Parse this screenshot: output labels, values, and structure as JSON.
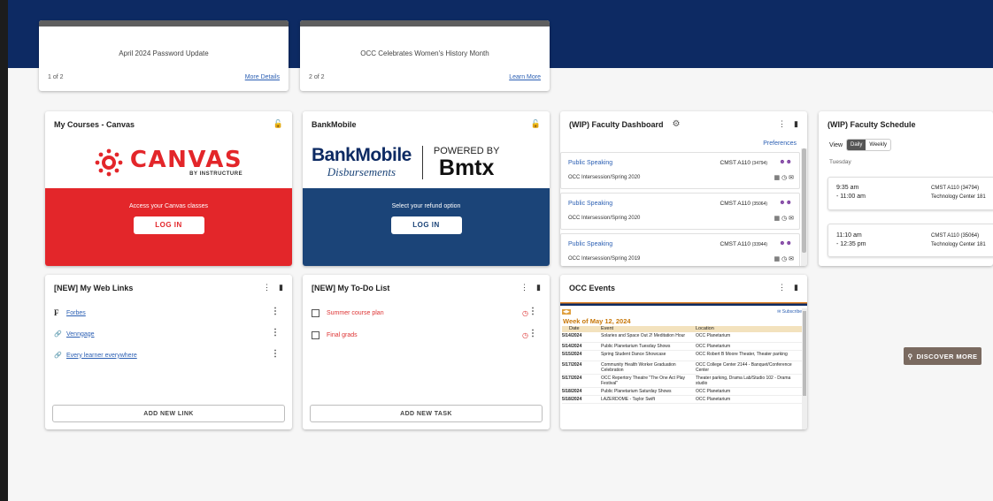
{
  "announcements": [
    {
      "title": "April 2024 Password Update",
      "counter": "1 of 2",
      "link": "More Details"
    },
    {
      "title": "OCC Celebrates Women's History Month",
      "counter": "2 of 2",
      "link": "Learn More"
    }
  ],
  "canvas": {
    "title": "My Courses - Canvas",
    "logo_text": "CANVAS",
    "logo_sub": "BY INSTRUCTURE",
    "message": "Access your Canvas classes",
    "button": "LOG IN"
  },
  "bankmobile": {
    "title": "BankMobile",
    "logo_main": "BankMobile",
    "logo_sub": "Disbursements",
    "powered": "POWERED BY",
    "bmtx": "Bmtx",
    "message": "Select your refund option",
    "button": "LOG IN"
  },
  "dashboard": {
    "title": "(WIP) Faculty Dashboard",
    "preferences": "Preferences",
    "courses": [
      {
        "name": "Public Speaking",
        "code": "CMST A110",
        "id": "(34794)",
        "term": "OCC Intersession/Spring 2020"
      },
      {
        "name": "Public Speaking",
        "code": "CMST A110",
        "id": "(35064)",
        "term": "OCC Intersession/Spring 2020"
      },
      {
        "name": "Public Speaking",
        "code": "CMST A110",
        "id": "(33944)",
        "term": "OCC Intersession/Spring 2019"
      }
    ]
  },
  "schedule": {
    "title": "(WIP) Faculty Schedule",
    "view_label": "View",
    "tab_daily": "Daily",
    "tab_weekly": "Weekly",
    "day": "Tuesday",
    "entries": [
      {
        "start": "9:35 am",
        "end": "- 11:00 am",
        "course": "CMST A110 (34794)",
        "room": "Technology Center 181"
      },
      {
        "start": "11:10 am",
        "end": "- 12:35 pm",
        "course": "CMST A110 (35064)",
        "room": "Technology Center 181"
      }
    ]
  },
  "weblinks": {
    "title": "[NEW] My Web Links",
    "items": [
      "Forbes",
      "Venngage",
      "Every learner everywhere"
    ],
    "add": "ADD NEW LINK"
  },
  "todo": {
    "title": "[NEW] My To-Do List",
    "items": [
      "Summer course plan",
      "Final grads"
    ],
    "add": "ADD NEW TASK"
  },
  "events": {
    "title": "OCC Events",
    "subscribe": "Subscribe",
    "week": "Week of May 12, 2024",
    "cols": [
      "Date",
      "Event",
      "Location"
    ],
    "rows": [
      {
        "date": "5/14/2024",
        "event": "Solaries and Space Out 2! Meditation Hour",
        "location": "OCC Planetarium"
      },
      {
        "date": "5/14/2024",
        "event": "Public Planetarium Tuesday Shows",
        "location": "OCC Planetarium"
      },
      {
        "date": "5/15/2024",
        "event": "Spring Student Dance Showcase",
        "location": "OCC Robert B Moore Theater, Theater parking"
      },
      {
        "date": "5/17/2024",
        "event": "Community Health Worker Graduation Celebration",
        "location": "OCC College Center 2144 - Banquet/Conference Center"
      },
      {
        "date": "5/17/2024",
        "event": "OCC Repertory Theatre \"The One Act Play Festival\"",
        "location": "Theater parking, Drama Lab/Studio 102 - Drama studio"
      },
      {
        "date": "5/18/2024",
        "event": "Public Planetarium Saturday Shows",
        "location": "OCC Planetarium"
      },
      {
        "date": "5/18/2024",
        "event": "LAZERDOME - Taylor Swift",
        "location": "OCC Planetarium"
      }
    ]
  },
  "discover": {
    "label": "DISCOVER MORE"
  },
  "colors": {
    "navy": "#0d2a63",
    "canvas_red": "#e3262a",
    "bank_blue": "#1b4478",
    "discover": "#7a6a60"
  }
}
